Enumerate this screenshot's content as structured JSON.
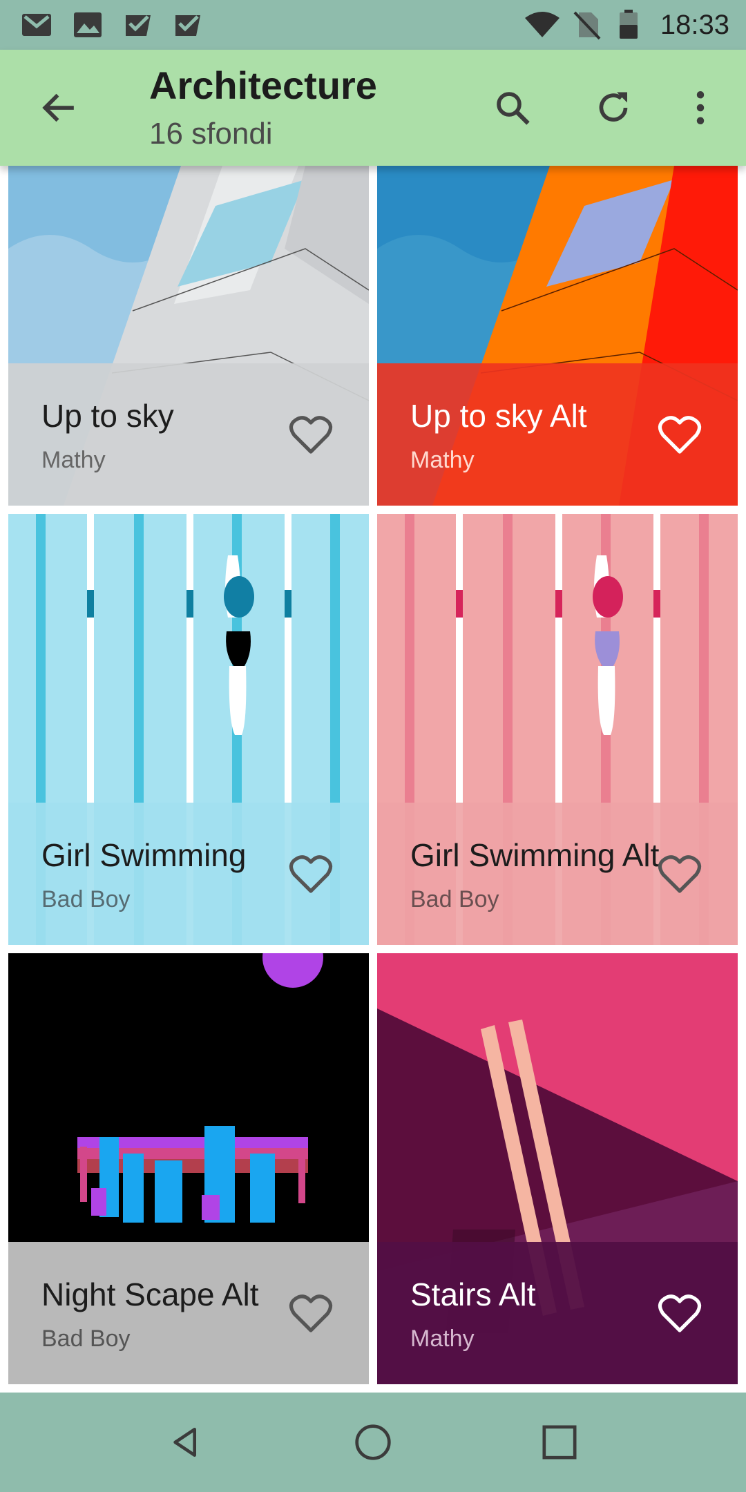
{
  "status_bar": {
    "time": "18:33",
    "left_icons": [
      "gmail-icon",
      "gallery-icon",
      "tasks-icon",
      "tasks-icon"
    ],
    "right_icons": [
      "wifi-icon",
      "no-sim-icon",
      "battery-icon"
    ]
  },
  "app_bar": {
    "title": "Architecture",
    "subtitle": "16 sfondi",
    "background": "#acdfa8",
    "actions": [
      "back-arrow-icon",
      "search-icon",
      "refresh-icon",
      "more-vert-icon"
    ]
  },
  "wallpapers": [
    {
      "title": "Up to sky",
      "author": "Mathy",
      "favorite": false,
      "info_bg": "#cfd1d3",
      "text_color": "#1c1c1c",
      "author_color": "#666666"
    },
    {
      "title": "Up to sky Alt",
      "author": "Mathy",
      "favorite": false,
      "info_bg": "#f0331f",
      "text_color": "#ffffff",
      "author_color": "#ffe0d8"
    },
    {
      "title": "Girl Swimming",
      "author": "Bad Boy",
      "favorite": false,
      "info_bg": "#a2e0f0",
      "text_color": "#1c1c1c",
      "author_color": "#566b72"
    },
    {
      "title": "Girl Swimming Alt",
      "author": "Bad Boy",
      "favorite": false,
      "info_bg": "#eea3a5",
      "text_color": "#1c1c1c",
      "author_color": "#6a4f50"
    },
    {
      "title": "Night Scape Alt",
      "author": "Bad Boy",
      "favorite": false,
      "info_bg": "#b9b9b9",
      "text_color": "#1c1c1c",
      "author_color": "#555555"
    },
    {
      "title": "Stairs Alt",
      "author": "Mathy",
      "favorite": false,
      "info_bg": "#520f45",
      "text_color": "#ffffff",
      "author_color": "#d6b8cf"
    }
  ],
  "nav_bar": {
    "buttons": [
      "back-triangle-icon",
      "home-circle-icon",
      "recents-square-icon"
    ],
    "background": "#8fbcac"
  }
}
